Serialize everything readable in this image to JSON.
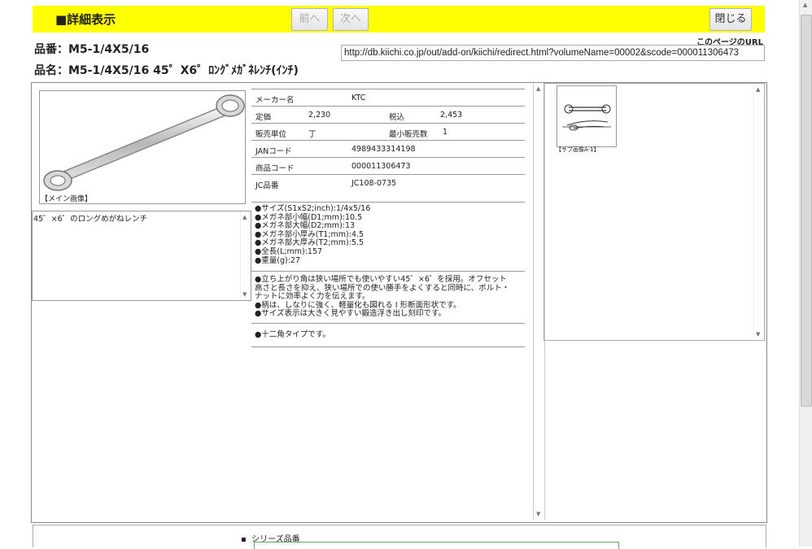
{
  "header": {
    "title": "■詳細表示",
    "prev_label": "前へ",
    "next_label": "次へ",
    "close_label": "閉じる"
  },
  "page_url": {
    "caption": "このページのURL",
    "value": "http://db.kiichi.co.jp/out/add-on/kiichi/redirect.html?volumeName=00002&scode=000011306473"
  },
  "product": {
    "hinban": "品番：M5-1/4X5/16",
    "hinmei": "品名：M5-1/4X5/16 45゜X6゜ﾛﾝｸﾞﾒｶﾞﾈﾚﾝﾁ(ｲﾝﾁ)"
  },
  "main_image": {
    "caption": "【メイン画像】"
  },
  "description": "45゜×6゜のロングめがねレンチ",
  "spec": {
    "maker_label": "メーカー名",
    "maker": "KTC",
    "price_label": "定価",
    "price": "2,230",
    "taxin_label": "税込",
    "taxin": "2,453",
    "unit_label": "販売単位",
    "unit": "丁",
    "minqty_label": "最小販売数",
    "minqty": "1",
    "jan_label": "JANコード",
    "jan": "4989433314198",
    "code_label": "商品コード",
    "code": "000011306473",
    "jc_label": "JC品番",
    "jc": "JC108-0735"
  },
  "features": [
    "●サイズ(S1xS2;inch):1/4x5/16",
    "●メガネ部小幅(D1;mm):10.5",
    "●メガネ部大幅(D2;mm):13",
    "●メガネ部小厚み(T1;mm):4.5",
    "●メガネ部大厚み(T2;mm):5.5",
    "●全長(L;mm):157",
    "●重量(g):27"
  ],
  "features2": [
    "●立ち上がり角は狭い場所でも使いやすい45゜×6゜を採用。オフセット",
    "高さと長さを抑え、狭い場所での使い勝手をよくすると同時に、ボルト・",
    "ナットに効率よく力を伝えます。",
    "●柄は、しなりに強く、軽量化も図れる I 形断面形状です。",
    "●サイズ表示は大きく見やすい鍛造浮き出し刻印です。"
  ],
  "features3": "●十二角タイプです。",
  "sub_image": {
    "caption": "【サブ画像A-1】"
  },
  "series": {
    "label": "シリーズ品番"
  }
}
